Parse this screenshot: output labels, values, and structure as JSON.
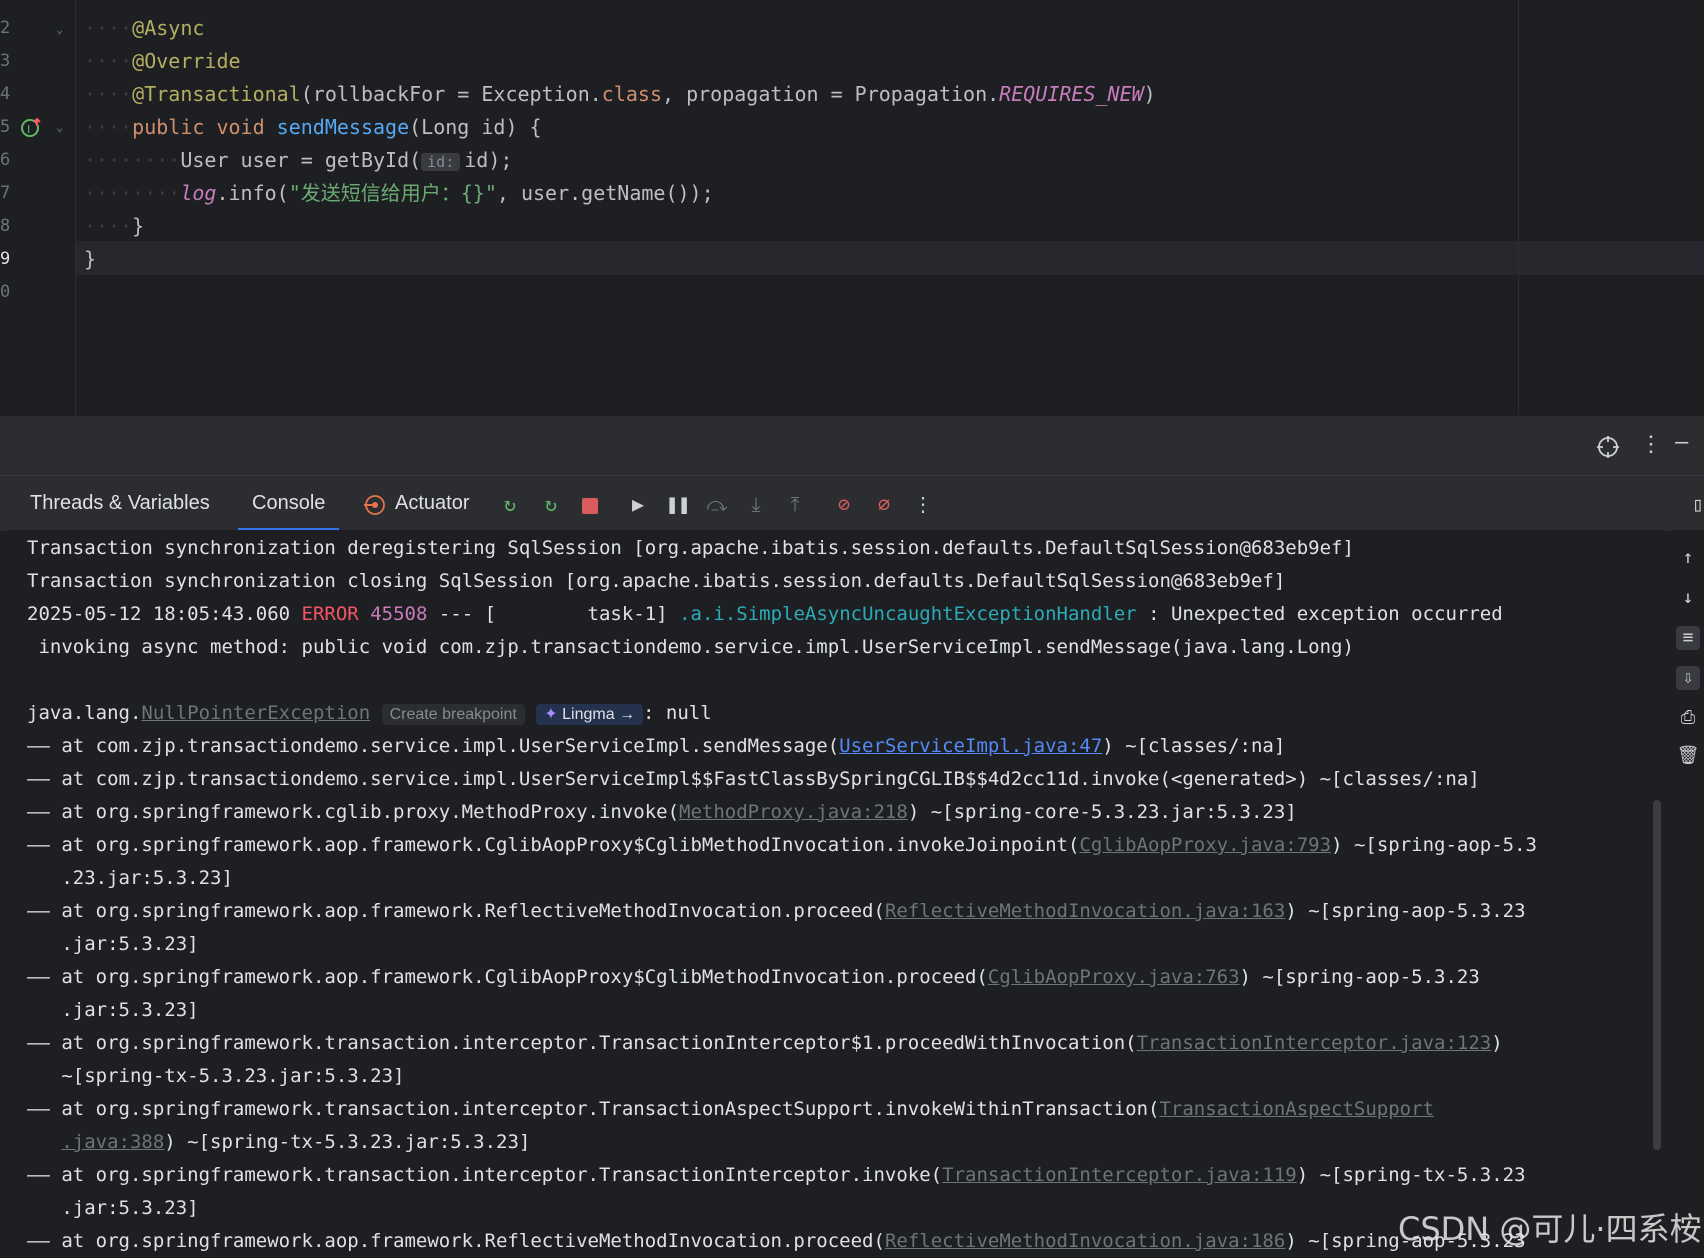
{
  "editor": {
    "line_numbers": [
      "2",
      "3",
      "4",
      "5",
      "6",
      "7",
      "8",
      "9",
      "0"
    ],
    "lines": {
      "l2_ann": "@Async",
      "l3_ann": "@Override",
      "l4_ann": "@Transactional",
      "l4_a": "(rollbackFor = Exception.",
      "l4_kw": "class",
      "l4_b": ", propagation = Propagation.",
      "l4_const": "REQUIRES_NEW",
      "l4_c": ")",
      "l5_kw": "public void ",
      "l5_fn": "sendMessage",
      "l5_rest": "(Long id) {",
      "l6_a": "User user = getById(",
      "l6_hint": "id:",
      "l6_b": "id);",
      "l7_log": "log",
      "l7_a": ".info(",
      "l7_str": "\"发送短信给用户：{}\"",
      "l7_b": ", user.getName());",
      "l8": "}",
      "l9": "}"
    }
  },
  "panel": {
    "tabs": [
      "Threads & Variables",
      "Console",
      "Actuator"
    ],
    "active_tab": "Console"
  },
  "console": {
    "l1": "Transaction synchronization deregistering SqlSession [org.apache.ibatis.session.defaults.DefaultSqlSession@683eb9ef]",
    "l2": "Transaction synchronization closing SqlSession [org.apache.ibatis.session.defaults.DefaultSqlSession@683eb9ef]",
    "l3_time": "2025-05-12 18:05:43.060 ",
    "l3_level": "ERROR",
    "l3_pid": " 45508",
    "l3_mid": " --- [        task-1] ",
    "l3_logger": ".a.i.SimpleAsyncUncaughtExceptionHandler",
    "l3_msg": " : Unexpected exception occurred",
    "l4": " invoking async method: public void com.zjp.transactiondemo.service.impl.UserServiceImpl.sendMessage(java.lang.Long)",
    "ex_prefix": "java.lang.",
    "ex_name": "NullPointerException",
    "create_bp": "Create breakpoint",
    "lingma": "Lingma →",
    "ex_msg": ": null",
    "s1_a": "—— at com.zjp.transactiondemo.service.impl.UserServiceImpl.sendMessage(",
    "s1_link": "UserServiceImpl.java:47",
    "s1_b": ") ~[classes/:na]",
    "s2": "—— at com.zjp.transactiondemo.service.impl.UserServiceImpl$$FastClassBySpringCGLIB$$4d2cc11d.invoke(<generated>) ~[classes/:na]",
    "s3_a": "—— at org.springframework.cglib.proxy.MethodProxy.invoke(",
    "s3_link": "MethodProxy.java:218",
    "s3_b": ") ~[spring-core-5.3.23.jar:5.3.23]",
    "s4_a": "—— at org.springframework.aop.framework.CglibAopProxy$CglibMethodInvocation.invokeJoinpoint(",
    "s4_link": "CglibAopProxy.java:793",
    "s4_b": ") ~[spring-aop-5.3",
    "s4_c": "   .23.jar:5.3.23]",
    "s5_a": "—— at org.springframework.aop.framework.ReflectiveMethodInvocation.proceed(",
    "s5_link": "ReflectiveMethodInvocation.java:163",
    "s5_b": ") ~[spring-aop-5.3.23",
    "s5_c": "   .jar:5.3.23]",
    "s6_a": "—— at org.springframework.aop.framework.CglibAopProxy$CglibMethodInvocation.proceed(",
    "s6_link": "CglibAopProxy.java:763",
    "s6_b": ") ~[spring-aop-5.3.23",
    "s6_c": "   .jar:5.3.23]",
    "s7_a": "—— at org.springframework.transaction.interceptor.TransactionInterceptor$1.proceedWithInvocation(",
    "s7_link": "TransactionInterceptor.java:123",
    "s7_b": ")",
    "s7_c": "   ~[spring-tx-5.3.23.jar:5.3.23]",
    "s8_a": "—— at org.springframework.transaction.interceptor.TransactionAspectSupport.invokeWithinTransaction(",
    "s8_link": "TransactionAspectSupport",
    "s8_link2": ".java:388",
    "s8_c": ") ~[spring-tx-5.3.23.jar:5.3.23]",
    "s9_a": "—— at org.springframework.transaction.interceptor.TransactionInterceptor.invoke(",
    "s9_link": "TransactionInterceptor.java:119",
    "s9_b": ") ~[spring-tx-5.3.23",
    "s9_c": "   .jar:5.3.23]",
    "s10_a": "—— at org.springframework.aop.framework.ReflectiveMethodInvocation.proceed(",
    "s10_link": "ReflectiveMethodInvocation.java:186",
    "s10_b": ") ~[spring-aop-5.3.23"
  },
  "watermark": "CSDN @可儿·四系桉"
}
